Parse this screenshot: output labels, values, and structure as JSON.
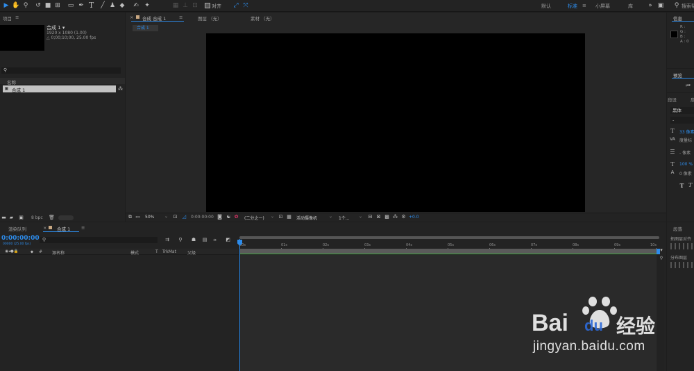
{
  "toolbar": {
    "snap_label": "对齐",
    "workspaces": [
      "默认",
      "标准",
      "小屏幕",
      "库"
    ],
    "search_placeholder": "搜索帮助"
  },
  "project": {
    "tab": "项目",
    "comp_name": "合成 1 ▾",
    "comp_size": "1920 x 1080 (1.00)",
    "comp_duration": "△ 0;00;10;00, 25.00 fps",
    "col_name": "名称",
    "item_label": "合成 1",
    "bpc": "8 bpc"
  },
  "viewer": {
    "comp_tab": "合成 合成 1",
    "layer_tab": "图层 （无）",
    "footage_tab": "素材 （无）",
    "breadcrumb": "合成 1",
    "zoom": "50%",
    "timecode": "0:00:00:00",
    "resolution": "(二分之一)",
    "camera": "活动摄像机",
    "views": "1个...",
    "exposure": "+0.0"
  },
  "info": {
    "tab": "信息",
    "rows": [
      "R :",
      "G :",
      "B :",
      "A : 0"
    ]
  },
  "preview": {
    "tab": "预览"
  },
  "character": {
    "tab": "段设",
    "font": "黑体",
    "style": "-",
    "size": "33 像素",
    "tracking": "度量标",
    "leading": "- 像素",
    "vscale": "100 %",
    "baseline": "0 像素"
  },
  "paragraph": {
    "tab": "段落",
    "row1": "拓图层对齐",
    "row2": "分布图层"
  },
  "timeline": {
    "render_tab": "渲染队列",
    "comp_tab": "合成 1",
    "timecode": "0:00:00:00",
    "frame_info": "00000 (25.00 fps)",
    "cols": {
      "hash": "#",
      "source": "源名称",
      "mode": "模式",
      "t": "T",
      "trkmat": "TrkMat",
      "parent": "父级"
    },
    "ruler": [
      "00s",
      "01s",
      "02s",
      "03s",
      "04s",
      "05s",
      "06s",
      "07s",
      "08s",
      "09s",
      "10s"
    ]
  },
  "watermark": {
    "logo_text": "Bai",
    "logo_text2": "du",
    "brand": "经验",
    "url": "jingyan.baidu.com"
  }
}
